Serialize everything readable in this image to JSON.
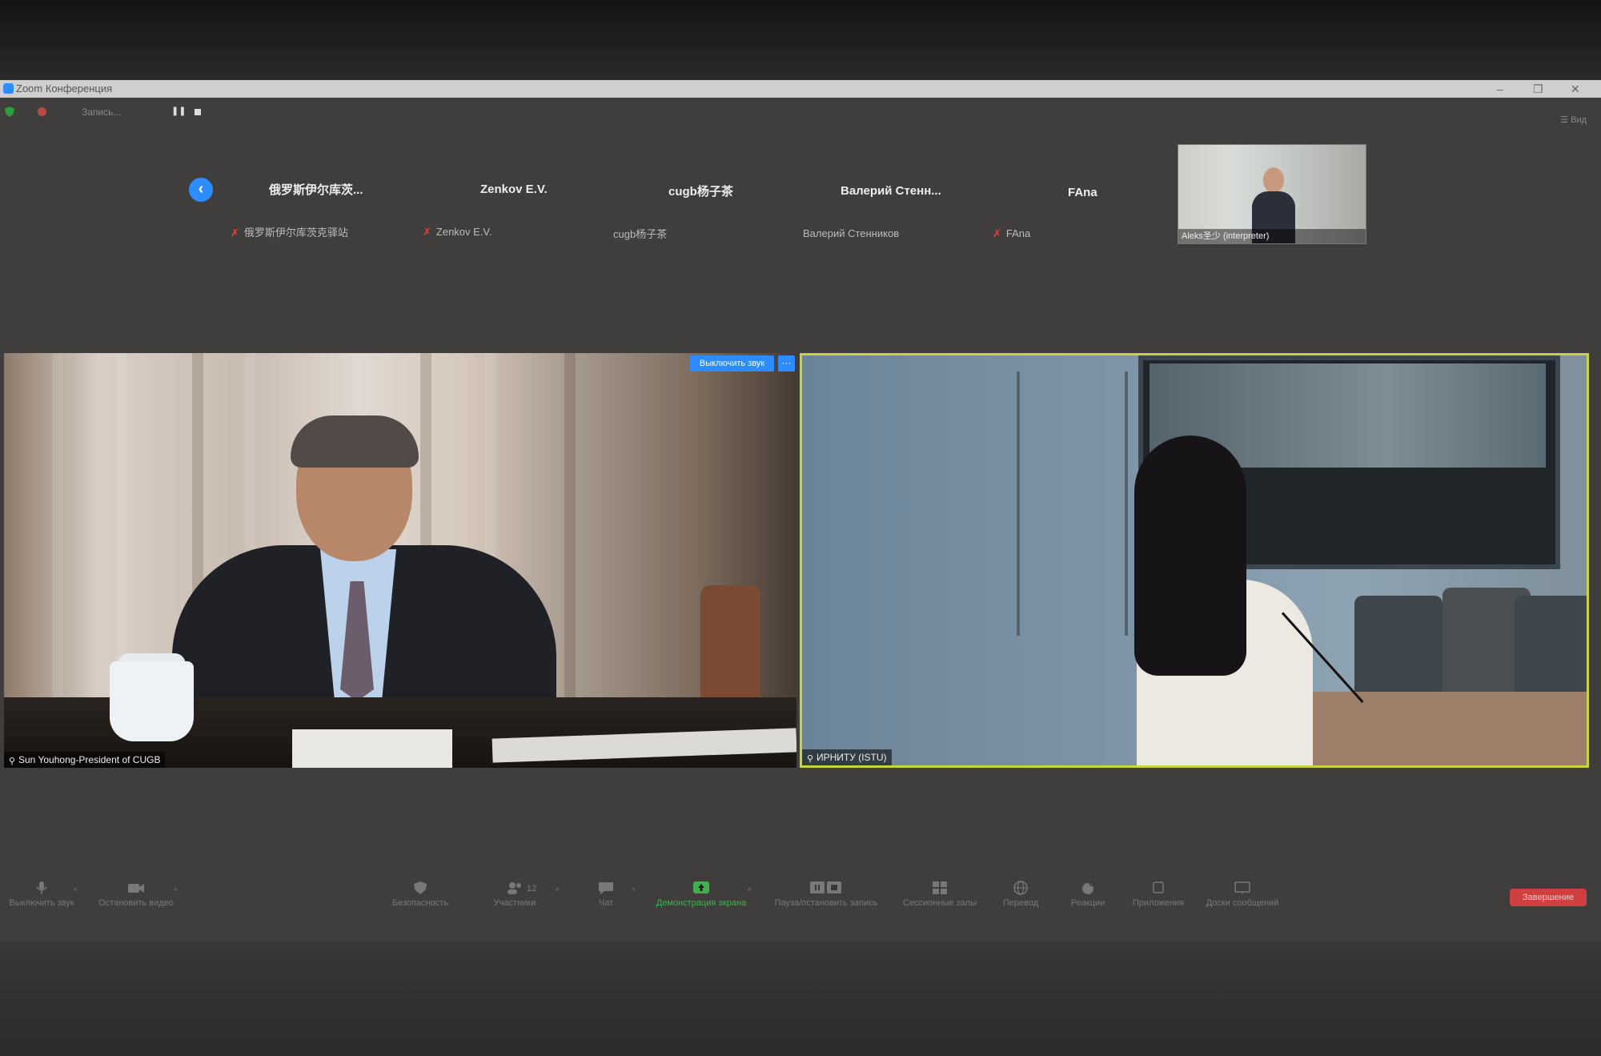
{
  "window": {
    "title": "Zoom Конференция",
    "controls": [
      "–",
      "❐",
      "✕"
    ]
  },
  "recording": {
    "label": "Запись...",
    "pause_icon": "❚❚"
  },
  "view_button": "Вид",
  "participant_strip": [
    {
      "name": "俄罗斯伊尔库茨...",
      "sub": "俄罗斯伊尔库茨克驿站",
      "muted": true
    },
    {
      "name": "Zenkov E.V.",
      "sub": "Zenkov E.V.",
      "muted": true
    },
    {
      "name": "cugb杨子茶",
      "sub": "cugb杨子茶",
      "muted": false
    },
    {
      "name": "Валерий Стенн...",
      "sub": "Валерий Стенников",
      "muted": false
    },
    {
      "name": "FAna",
      "sub": "FAna",
      "muted": true
    }
  ],
  "thumbnail_video": {
    "label": "Aleks圣少 (interpreter)"
  },
  "main_videos": [
    {
      "label": "Sun Youhong-President of CUGB",
      "unmute_label": "Выключить звук",
      "more_label": "···"
    },
    {
      "label": "ИРНИТУ (ISTU)"
    }
  ],
  "toolbar": {
    "mute": "Выключить звук",
    "video": "Остановить видео",
    "security": "Безопасность",
    "participants": "Участники",
    "participants_count": "12",
    "chat": "Чат",
    "share": "Демонстрация экрана",
    "record": "Пауза/остановить запись",
    "breakout": "Сессионные залы",
    "translate": "Перевод",
    "reactions": "Реакции",
    "apps": "Приложения",
    "whiteboard": "Доски сообщений",
    "end": "Завершение"
  },
  "colors": {
    "zoom_blue": "#2d8cff",
    "active_speaker_border": "#c8d43c",
    "share_green": "#3fb24f",
    "end_red": "#d04040"
  }
}
